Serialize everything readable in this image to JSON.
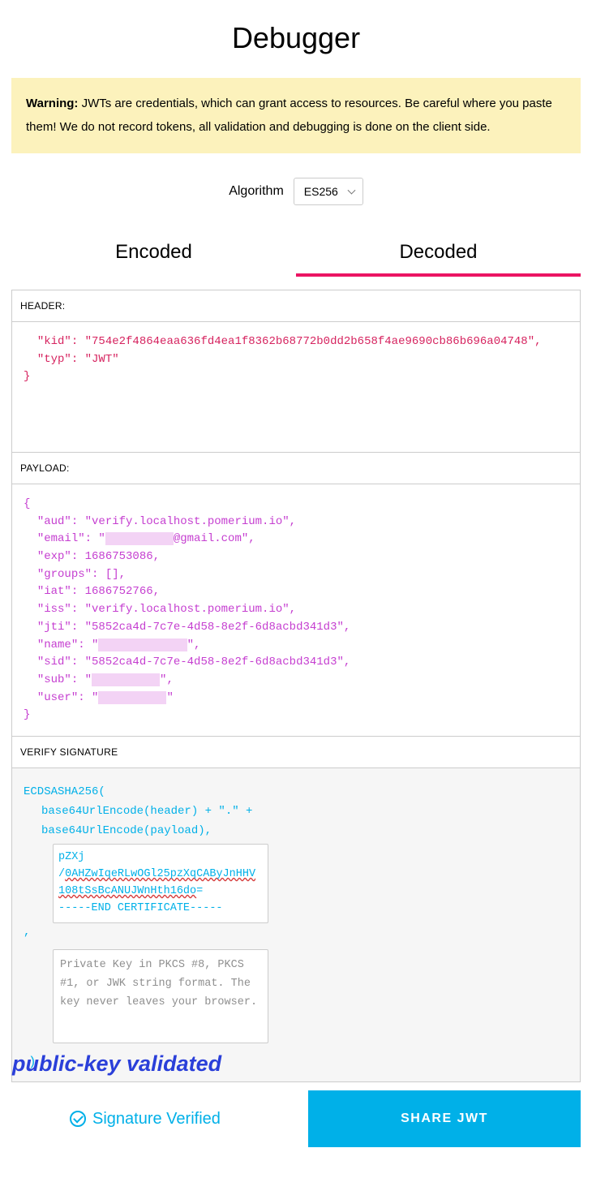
{
  "title": "Debugger",
  "warning": {
    "label": "Warning:",
    "text": " JWTs are credentials, which can grant access to resources. Be careful where you paste them! We do not record tokens, all validation and debugging is done on the client side."
  },
  "algorithm": {
    "label": "Algorithm",
    "selected": "ES256"
  },
  "tabs": {
    "encoded": "Encoded",
    "decoded": "Decoded",
    "active": "decoded"
  },
  "sections": {
    "header_label": "HEADER:",
    "payload_label": "PAYLOAD:",
    "verify_label": "VERIFY SIGNATURE"
  },
  "header_json": "  \"kid\": \"754e2f4864eaa636fd4ea1f8362b68772b0dd2b658f4ae9690cb86b696a04748\",\n  \"typ\": \"JWT\"\n}",
  "payload_json_pre": "{\n  \"aud\": \"verify.localhost.pomerium.io\",\n  \"email\": \"",
  "payload_email_redacted": "xxxxxxxxxx",
  "payload_email_tail": "@gmail.com\",",
  "payload_mid": "\n  \"exp\": 1686753086,\n  \"groups\": [],\n  \"iat\": 1686752766,\n  \"iss\": \"verify.localhost.pomerium.io\",\n  \"jti\": \"5852ca4d-7c7e-4d58-8e2f-6d8acbd341d3\",\n  \"name\": \"",
  "payload_name_redacted": "xxxx xxxxxxxx",
  "payload_after_name": "\",\n  \"sid\": \"5852ca4d-7c7e-4d58-8e2f-6d8acbd341d3\",\n  \"sub\": \"",
  "payload_sub_redacted": "xxxxxxxxxx",
  "payload_after_sub": "\",\n  \"user\": \"",
  "payload_user_redacted": "xxxxxxxxxx",
  "payload_end": "\"\n}",
  "verify": {
    "line1": "ECDSASHA256(",
    "line2": "base64UrlEncode(header) + \".\" +",
    "line3": "base64UrlEncode(payload),",
    "pub_plain1": "pZXj",
    "pub_slash": "/",
    "pub_red1": "0AHZwIqeRLwOGl25pzXqCAByJnHHV",
    "pub_red2": "108tSsBcANUJWnHth16do",
    "pub_eq": "=",
    "pub_end": "-----END CERTIFICATE-----",
    "priv_placeholder": "Private Key in PKCS #8, PKCS #1, or JWK string format. The key never leaves your browser.",
    "close": ")"
  },
  "annotation": "public-key validated",
  "footer": {
    "verified": "Signature Verified",
    "share": "SHARE JWT"
  }
}
